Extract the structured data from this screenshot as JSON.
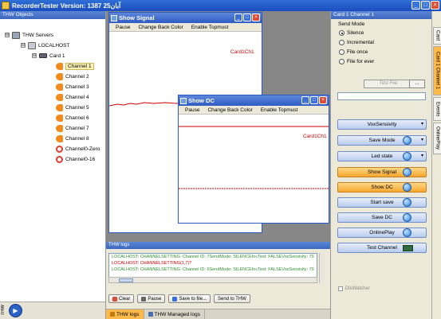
{
  "app": {
    "title": "RecorderTester Version: 1387 آبان25"
  },
  "window_controls": {
    "minimize": "_",
    "maximize": "□",
    "close": "×"
  },
  "left_panel": {
    "header": "THW Objects",
    "tree": {
      "servers": "THW Servers",
      "host": "LOCALHOST",
      "card": "Card 1",
      "channels": [
        "Channel 1",
        "Channel 2",
        "Channel 3",
        "Channel 4",
        "Channel 5",
        "Channel 6",
        "Channel 7",
        "Channel 8",
        "Channel0-Zero",
        "Channel0-16"
      ],
      "expanders": [
        "⊟",
        "⊟",
        "⊟"
      ]
    },
    "footer_tab": "THW",
    "play_glyph": "▶"
  },
  "show_signal": {
    "title": "Show Signal",
    "menu": [
      "Pause",
      "Change Back Color",
      "Enable Topmust"
    ],
    "series_label": "Card1Ch1",
    "line_color": "#cc0000"
  },
  "show_dc": {
    "title": "Show DC",
    "menu": [
      "Pause",
      "Change Back Color",
      "Enable Topmust"
    ],
    "series_label": "Card1Ch1",
    "line_color": "#cc0000"
  },
  "logs": {
    "header": "THW logs",
    "lines": [
      {
        "text": "LOCALHOST: CHANNELSETTING: Channel ID: 7SendMode: SILENCEIncTest: FALSEVoxSensivity: 79",
        "color": "green"
      },
      {
        "text": "LOCALHOST: CHANNELSETTING(1,7)?",
        "color": "red"
      },
      {
        "text": "LOCALHOST: CHANNELSETTING: Channel ID: 6SendMode: SILENCEIncTest: FALSEVoxSensivity: 79",
        "color": "green"
      }
    ],
    "toolbar": {
      "clear": "Clear",
      "pause": "Pause",
      "save": "Save to file...",
      "send": "Send to THW"
    },
    "tabs": [
      "THW logs",
      "THW Managed logs"
    ]
  },
  "right_panel": {
    "header": "Card 1 Channel 1",
    "send_mode_label": "Send Mode",
    "send_modes": [
      {
        "label": "Silence",
        "selected": true
      },
      {
        "label": "Incremental",
        "selected": false
      },
      {
        "label": "File once",
        "selected": false
      },
      {
        "label": "File for ever",
        "selected": false
      }
    ],
    "test_file": "Test File",
    "dots": "...",
    "buttons": {
      "vox": "VoxSensivity",
      "save_mode": "Save Mode",
      "led_state": "Led state",
      "show_signal": "Show Signal",
      "show_dc": "Show DC",
      "start_save": "Start save",
      "save_dc": "Save DC",
      "online_play": "OnlinePlay",
      "test_channel": "Test Channel"
    },
    "chevron": "▾",
    "diswatcher": "DisWatcher"
  },
  "right_tabs": [
    "Card",
    "Card 1 Channel 1",
    "Events",
    "OnlinePlay"
  ]
}
